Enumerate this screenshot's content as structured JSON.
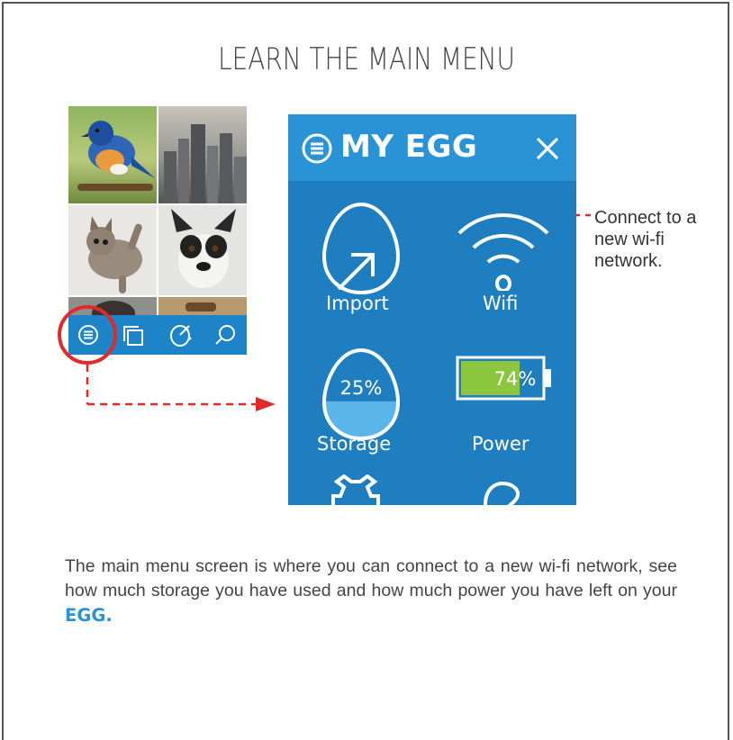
{
  "page": {
    "title": "LEARN THE MAIN MENU",
    "callout": "Connect to a new wi-fi network.",
    "body_text": "The main menu screen is where you can connect to a new wi-fi network, see how much storage you have used and how much power you have left on your",
    "body_brand": "EGG."
  },
  "menu": {
    "title": "MY EGG",
    "items": [
      {
        "label": "Import",
        "icon": "import-egg-icon"
      },
      {
        "label": "Wifi",
        "icon": "wifi-icon"
      },
      {
        "label": "Storage",
        "icon": "storage-egg-icon",
        "value_label": "25%",
        "value": 0.25
      },
      {
        "label": "Power",
        "icon": "battery-icon",
        "value_label": "74%",
        "value": 0.74
      }
    ]
  },
  "thumbnail": {
    "photos": [
      "bird-photo",
      "city-photo",
      "kitten-photo",
      "puppy-photo",
      "baby-photo",
      "dog-beach-photo"
    ],
    "toolbar_icons": [
      "menu-icon",
      "gallery-icon",
      "import-icon",
      "search-icon"
    ]
  },
  "colors": {
    "accent": "#1f7ec0",
    "header": "#2a93d6",
    "highlight_red": "#e02a2a",
    "battery_green": "#8cc63f",
    "storage_fill": "#5bb5ea"
  }
}
